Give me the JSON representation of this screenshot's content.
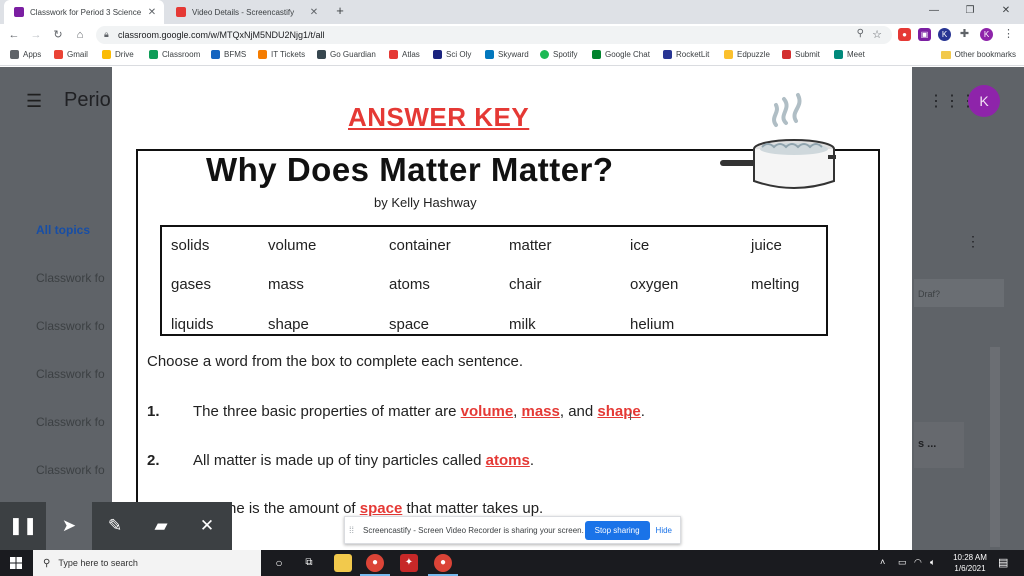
{
  "browser": {
    "tabs": [
      {
        "label": "Classwork for Period 3 Science",
        "favicon_color": "#7b1fa2"
      },
      {
        "label": "Video Details - Screencastify",
        "favicon_color": "#e53935"
      }
    ],
    "new_tab_symbol": "+",
    "window_controls": [
      "—",
      "❐",
      "✕"
    ],
    "url": "classroom.google.com/w/MTQxNjM5NDU2Njg1/t/all",
    "profile_initial": "K",
    "extension_initial": "K"
  },
  "bookmarks": {
    "items": [
      {
        "label": "Apps",
        "color": "#5f6368"
      },
      {
        "label": "Gmail",
        "color": "#ea4335"
      },
      {
        "label": "Drive",
        "color": "#fbbc04"
      },
      {
        "label": "Classroom",
        "color": "#0f9d58"
      },
      {
        "label": "BFMS",
        "color": "#1565c0"
      },
      {
        "label": "IT Tickets",
        "color": "#f57c00"
      },
      {
        "label": "Go Guardian",
        "color": "#37474f"
      },
      {
        "label": "Atlas",
        "color": "#e53935"
      },
      {
        "label": "Sci Oly",
        "color": "#1a237e"
      },
      {
        "label": "Skyward",
        "color": "#0277bd"
      },
      {
        "label": "Spotify",
        "color": "#1db954"
      },
      {
        "label": "Google Chat",
        "color": "#00832d"
      },
      {
        "label": "RocketLit",
        "color": "#283593"
      },
      {
        "label": "Edpuzzle",
        "color": "#fbc02d"
      },
      {
        "label": "Submit",
        "color": "#d32f2f"
      },
      {
        "label": "Meet",
        "color": "#00897b"
      }
    ],
    "other": "Other bookmarks"
  },
  "classroom": {
    "title": "Perio",
    "avatar_initial": "K",
    "topics": [
      "All topics",
      "Classwork fo",
      "Classwork fo",
      "Classwork fo",
      "Classwork fo",
      "Classwork fo"
    ],
    "right_card_text": "Draf?",
    "right_card2_text": "s ..."
  },
  "worksheet": {
    "answer_key": "ANSWER KEY",
    "title": "Why Does Matter Matter?",
    "author": "by Kelly Hashway",
    "word_bank": [
      [
        "solids",
        "volume",
        "container",
        "matter",
        "ice",
        "juice"
      ],
      [
        "gases",
        "mass",
        "atoms",
        "chair",
        "oxygen",
        "melting"
      ],
      [
        "liquids",
        "shape",
        "space",
        "milk",
        "helium",
        ""
      ]
    ],
    "instructions": "Choose a word from the box to complete each sentence.",
    "questions": [
      {
        "num": "1.",
        "pre": "The three basic properties of matter are ",
        "a1": "volume",
        "mid1": ", ",
        "a2": "mass",
        "mid2": ", and ",
        "a3": "shape",
        "post": "."
      },
      {
        "num": "2.",
        "pre": "All matter is made up of tiny particles called ",
        "a1": "atoms",
        "post": "."
      },
      {
        "pre": "he is the amount of ",
        "a1": "space",
        "post": " that matter takes up."
      }
    ]
  },
  "screencastify": {
    "tools": [
      "pause-icon",
      "cursor-icon",
      "pen-icon",
      "eraser-icon",
      "close-icon"
    ],
    "share_message": "Screencastify - Screen Video Recorder is sharing your screen.",
    "stop_label": "Stop sharing",
    "hide_label": "Hide"
  },
  "taskbar": {
    "search_placeholder": "Type here to search",
    "time": "10:28 AM",
    "date": "1/6/2021"
  },
  "colors": {
    "answer_red": "#e53935",
    "share_blue": "#1a73e8",
    "taskbar": "#1a1b1f"
  }
}
